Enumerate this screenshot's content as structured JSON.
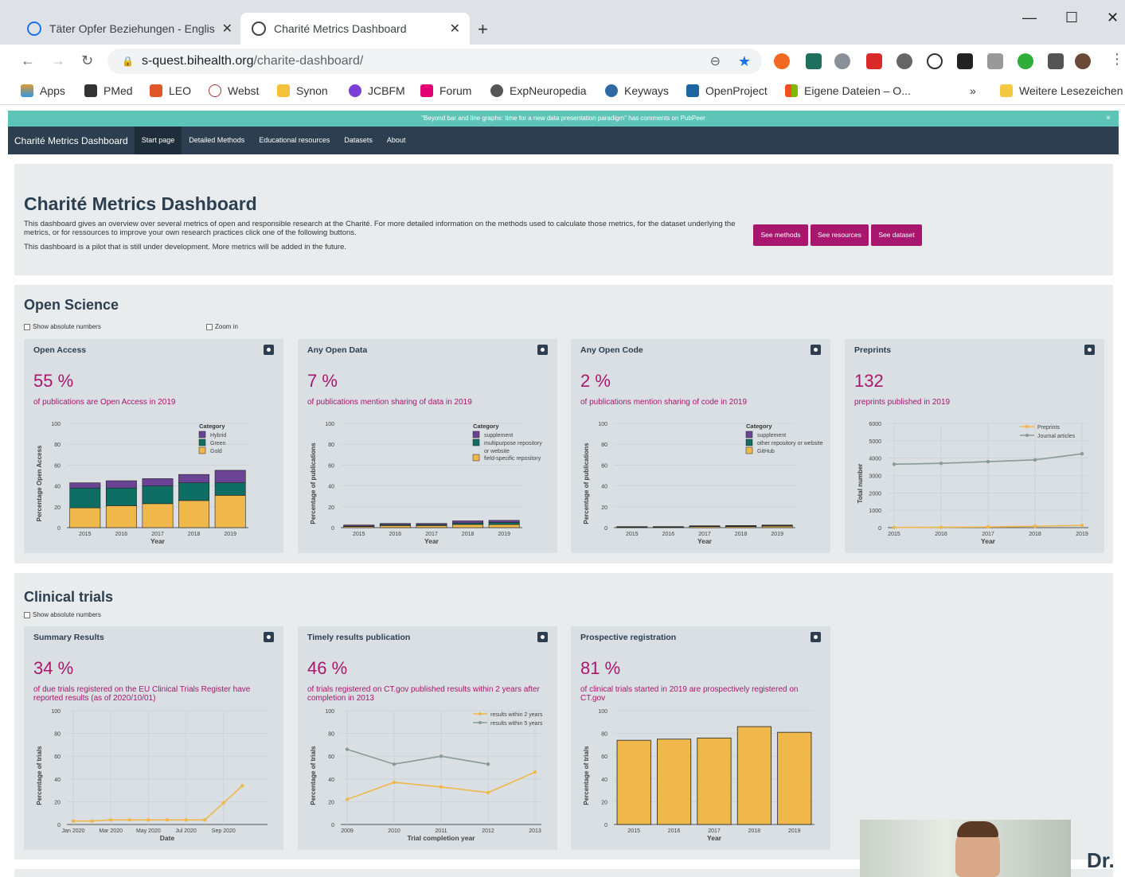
{
  "browser": {
    "tabs": [
      {
        "title": "Täter Opfer Beziehungen - Englis"
      },
      {
        "title": "Charité Metrics Dashboard"
      }
    ],
    "url_host": "s-quest.bihealth.org",
    "url_path": "/charite-dashboard/",
    "more_bookmarks": "Weitere Lesezeichen",
    "chevron": "»",
    "bookmarks": [
      "Apps",
      "PMed",
      "LEO",
      "Webst",
      "Synon",
      "JCBFM",
      "Forum",
      "ExpNeuropedia",
      "Keyways",
      "OpenProject",
      "Eigene Dateien – O..."
    ]
  },
  "banner": {
    "text": "\"Beyond bar and line graphs: time for a new data presentation paradigm\" has comments on PubPeer",
    "close": "×"
  },
  "nav": {
    "brand": "Charité Metrics Dashboard",
    "items": [
      "Start page",
      "Detailed Methods",
      "Educational resources",
      "Datasets",
      "About"
    ]
  },
  "intro": {
    "title": "Charité Metrics Dashboard",
    "p1": "This dashboard gives an overview over several metrics of open and responsible research at the Charité. For more detailed information on the methods used to calculate those metrics, for the dataset underlying the metrics, or for ressources to improve your own research practices click one of the following buttons.",
    "p2": "This dashboard is a pilot that is still under development. More metrics will be added in the future.",
    "buttons": [
      "See methods",
      "See resources",
      "See dataset"
    ]
  },
  "open_science": {
    "heading": "Open Science",
    "show_abs": "Show absolute numbers",
    "zoom": "Zoom in"
  },
  "clinical": {
    "heading": "Clinical trials",
    "show_abs": "Show absolute numbers"
  },
  "cards": [
    {
      "title": "Open Access",
      "value": "55 %",
      "caption": "of publications are Open Access in 2019"
    },
    {
      "title": "Any Open Data",
      "value": "7 %",
      "caption": "of publications mention sharing of data in 2019"
    },
    {
      "title": "Any Open Code",
      "value": "2 %",
      "caption": "of publications mention sharing of code in 2019"
    },
    {
      "title": "Preprints",
      "value": "132",
      "caption": "preprints published in 2019"
    },
    {
      "title": "Summary Results",
      "value": "34 %",
      "caption": "of due trials registered on the EU Clinical Trials Register have reported results (as of 2020/10/01)"
    },
    {
      "title": "Timely results publication",
      "value": "46 %",
      "caption": "of trials registered on CT.gov published results within 2 years after completion in 2013"
    },
    {
      "title": "Prospective registration",
      "value": "81 %",
      "caption": "of clinical trials started in 2019 are prospectively registered on CT.gov"
    }
  ],
  "photo_text": "Dr.",
  "chart_data": [
    {
      "type": "bar",
      "stacked": true,
      "categories": [
        "2015",
        "2016",
        "2017",
        "2018",
        "2019"
      ],
      "series": [
        {
          "name": "Gold",
          "color": "#f0b84a",
          "values": [
            19,
            21,
            23,
            26,
            31
          ]
        },
        {
          "name": "Green",
          "color": "#0f6e63",
          "values": [
            19,
            17,
            17,
            17,
            12
          ]
        },
        {
          "name": "Hybrid",
          "color": "#6b4394",
          "values": [
            5,
            7,
            7,
            8,
            12
          ]
        }
      ],
      "xlabel": "Year",
      "ylabel": "Percentage Open Access",
      "ylim": [
        0,
        100
      ],
      "yticks": [
        0,
        20,
        40,
        60,
        80,
        100
      ],
      "legend_title": "Category",
      "legend": [
        "Hybrid",
        "Green",
        "Gold"
      ]
    },
    {
      "type": "bar",
      "stacked": true,
      "categories": [
        "2015",
        "2016",
        "2017",
        "2018",
        "2019"
      ],
      "series": [
        {
          "name": "field-specific repository",
          "color": "#f0b84a",
          "values": [
            1,
            2,
            2,
            3,
            3
          ]
        },
        {
          "name": "multipurpose repository or website",
          "color": "#0f6e63",
          "values": [
            0.5,
            1,
            1,
            1.5,
            2
          ]
        },
        {
          "name": "supplement",
          "color": "#6b4394",
          "values": [
            1,
            1,
            1,
            2,
            2
          ]
        }
      ],
      "xlabel": "Year",
      "ylabel": "Percentage of publications",
      "ylim": [
        0,
        100
      ],
      "yticks": [
        0,
        20,
        40,
        60,
        80,
        100
      ],
      "legend_title": "Category",
      "legend": [
        "supplement",
        "multipurpose repository",
        "or website",
        "field-specific repository"
      ]
    },
    {
      "type": "bar",
      "stacked": true,
      "categories": [
        "2015",
        "2016",
        "2017",
        "2018",
        "2019"
      ],
      "series": [
        {
          "name": "GitHub",
          "color": "#f0b84a",
          "values": [
            0.5,
            0.5,
            1,
            1,
            1.5
          ]
        },
        {
          "name": "other repository or website",
          "color": "#0f6e63",
          "values": [
            0.2,
            0.3,
            0.3,
            0.5,
            0.5
          ]
        },
        {
          "name": "supplement",
          "color": "#6b4394",
          "values": [
            0.3,
            0.2,
            0.5,
            0.5,
            0.5
          ]
        }
      ],
      "xlabel": "Year",
      "ylabel": "Percentage of publications",
      "ylim": [
        0,
        100
      ],
      "yticks": [
        0,
        20,
        40,
        60,
        80,
        100
      ],
      "legend_title": "Category",
      "legend": [
        "supplement",
        "other repository or website",
        "GitHub"
      ]
    },
    {
      "type": "line",
      "x": [
        "2015",
        "2016",
        "2017",
        "2018",
        "2019"
      ],
      "series": [
        {
          "name": "Preprints",
          "color": "#f0b84a",
          "values": [
            10,
            20,
            40,
            80,
            132
          ]
        },
        {
          "name": "Journal articles",
          "color": "#8a9a94",
          "values": [
            3650,
            3700,
            3800,
            3900,
            4250
          ]
        }
      ],
      "xlabel": "Year",
      "ylabel": "Total number",
      "ylim": [
        0,
        6000
      ],
      "yticks": [
        0,
        1000,
        2000,
        3000,
        4000,
        5000,
        6000
      ]
    },
    {
      "type": "line",
      "x": [
        "Jan 2020",
        "",
        "Mar 2020",
        "",
        "May 2020",
        "",
        "Jul 2020",
        "",
        "Sep 2020",
        "",
        ""
      ],
      "xticks": [
        "Jan 2020",
        "Mar 2020",
        "May 2020",
        "Jul 2020",
        "Sep 2020"
      ],
      "series": [
        {
          "name": "",
          "color": "#f0b84a",
          "values": [
            3,
            3,
            4,
            4,
            4,
            4,
            4,
            4,
            19,
            34
          ]
        }
      ],
      "xlabel": "Date",
      "ylabel": "Percentage of trials",
      "ylim": [
        0,
        100
      ],
      "yticks": [
        0,
        20,
        40,
        60,
        80,
        100
      ]
    },
    {
      "type": "line",
      "x": [
        "2009",
        "2010",
        "2011",
        "2012",
        "2013"
      ],
      "series": [
        {
          "name": "results within 2 years",
          "color": "#f0b84a",
          "values": [
            22,
            37,
            33,
            28,
            46
          ]
        },
        {
          "name": "results within 5 years",
          "color": "#8a9a94",
          "values": [
            66,
            53,
            60,
            53,
            null
          ]
        }
      ],
      "xlabel": "Trial completion year",
      "ylabel": "Percentage of trials",
      "ylim": [
        0,
        100
      ],
      "yticks": [
        0,
        20,
        40,
        60,
        80,
        100
      ]
    },
    {
      "type": "bar",
      "categories": [
        "2015",
        "2016",
        "2017",
        "2018",
        "2019"
      ],
      "values": [
        74,
        75,
        76,
        86,
        81
      ],
      "color": "#f0b84a",
      "xlabel": "Year",
      "ylabel": "Percentage of trials",
      "ylim": [
        0,
        100
      ],
      "yticks": [
        0,
        20,
        40,
        60,
        80,
        100
      ]
    }
  ]
}
